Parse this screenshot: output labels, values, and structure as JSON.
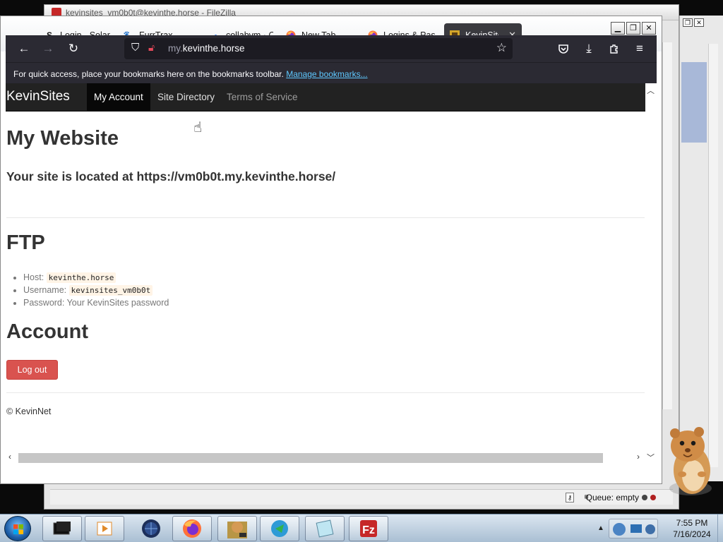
{
  "bg_filezilla": {
    "title": "kevinsites_vm0b0t@kevinthe.horse - FileZilla",
    "status": {
      "queue": "Queue: empty"
    }
  },
  "browser": {
    "tabs": [
      {
        "label": "Login - Solar",
        "icon": "S"
      },
      {
        "label": "FurrTrax -",
        "icon": "paw"
      },
      {
        "label": "collabvm · Ci",
        "icon": "dot"
      },
      {
        "label": "New Tab",
        "icon": "firefox"
      },
      {
        "label": "Logins & Pas",
        "icon": "firefox"
      },
      {
        "label": "KevinSites",
        "icon": "kevinsites",
        "active": true
      }
    ],
    "url_prefix": "my.",
    "url_domain": "kevinthe.horse",
    "bookmarks_text": "For quick access, place your bookmarks here on the bookmarks toolbar.",
    "bookmarks_link": "Manage bookmarks..."
  },
  "site": {
    "brand": "KevinSites",
    "nav": [
      "My Account",
      "Site Directory",
      "Terms of Service"
    ],
    "heading_website": "My Website",
    "site_location": "Your site is located at https://vm0b0t.my.kevinthe.horse/",
    "heading_ftp": "FTP",
    "ftp": {
      "host_label": "Host:",
      "host_value": "kevinthe.horse",
      "username_label": "Username:",
      "username_value": "kevinsites_vm0b0t",
      "password_label": "Password:",
      "password_value": "Your KevinSites password"
    },
    "heading_account": "Account",
    "logout_label": "Log out",
    "footer": "© KevinNet"
  },
  "taskbar": {
    "time": "7:55 PM",
    "date": "7/16/2024",
    "apps": [
      "terminal",
      "media-player",
      "browser-globe",
      "firefox",
      "hamster-box",
      "download-manager",
      "notepad",
      "filezilla"
    ]
  },
  "colors": {
    "navbar": "#222222",
    "logout_button": "#d9534f",
    "toolbar": "#2b2a33"
  }
}
